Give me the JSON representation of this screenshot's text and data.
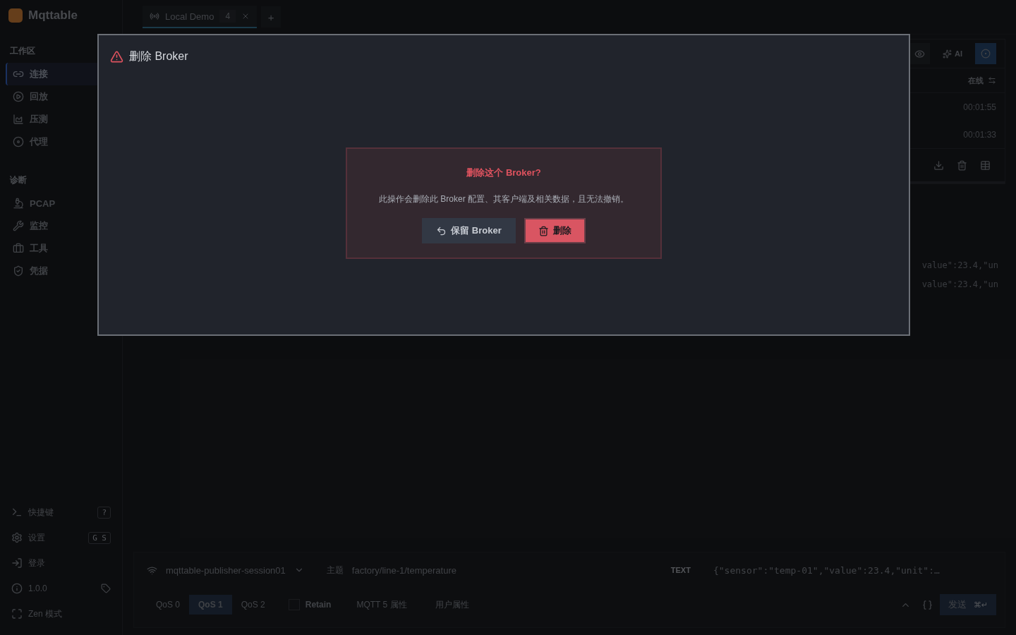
{
  "app": {
    "name": "Mqttable"
  },
  "sidebar": {
    "sections": [
      {
        "title": "工作区",
        "items": [
          {
            "label": "连接",
            "selected": true
          },
          {
            "label": "回放",
            "selected": false
          },
          {
            "label": "压测",
            "selected": false
          },
          {
            "label": "代理",
            "selected": false
          }
        ]
      },
      {
        "title": "诊断",
        "items": [
          {
            "label": "PCAP",
            "selected": false
          },
          {
            "label": "监控",
            "selected": false
          },
          {
            "label": "工具",
            "selected": false
          },
          {
            "label": "凭据",
            "selected": false
          }
        ]
      }
    ],
    "footer": [
      {
        "label": "快捷键",
        "shortcut": "?"
      },
      {
        "label": "设置",
        "shortcut": "G S"
      },
      {
        "label": "登录"
      },
      {
        "label": "1.0.0"
      },
      {
        "label": "Zen 模式"
      }
    ]
  },
  "tabs": [
    {
      "label": "Local Demo",
      "count": "4",
      "selected": true
    }
  ],
  "new_tab": "+",
  "toolbar": {
    "ai_label": "AI"
  },
  "clients": {
    "status_header": "在线",
    "rows": [
      {
        "duration": "00:01:55"
      },
      {
        "duration": "00:01:33"
      }
    ]
  },
  "messages": [
    {
      "payload": "value\":23.4,\"un"
    },
    {
      "payload": "value\":23.4,\"un"
    }
  ],
  "publisher": {
    "client": "mqttable-publisher-session01",
    "topic_label": "主题",
    "topic": "factory/line-1/temperature",
    "format": "TEXT",
    "payload": "{\"sensor\":\"temp-01\",\"value\":23.4,\"unit\":…",
    "qos": [
      {
        "label": "QoS 0",
        "selected": false
      },
      {
        "label": "QoS 1",
        "selected": true
      },
      {
        "label": "QoS 2",
        "selected": false
      }
    ],
    "retain": {
      "label": "Retain",
      "checked": false
    },
    "mqtt5_label": "MQTT 5 属性",
    "user_props_label": "用户属性",
    "send_label": "发送",
    "send_shortcut": "⌘↵"
  },
  "dialog": {
    "title": "删除 Broker",
    "confirm_title": "删除这个 Broker?",
    "message": "此操作会删除此 Broker 配置、其客户端及相关数据，且无法撤销。",
    "buttons": [
      {
        "label": "保留 Broker",
        "kind": "secondary"
      },
      {
        "label": "删除",
        "kind": "danger"
      }
    ]
  }
}
